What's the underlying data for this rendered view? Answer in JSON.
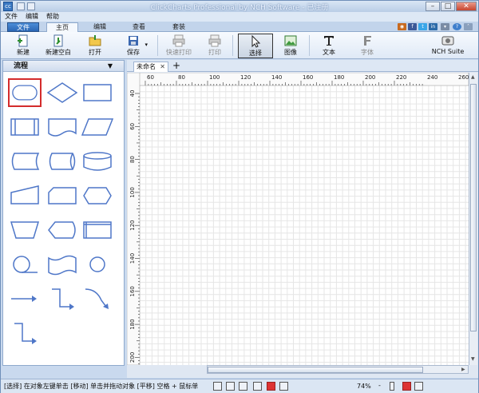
{
  "window": {
    "title": "ClickCharts Professional by NCH Software - 已注册",
    "controls": [
      "–",
      "□",
      "✕"
    ]
  },
  "menu": [
    "文件",
    "编辑",
    "帮助"
  ],
  "tabs": {
    "file": "文件",
    "items": [
      "主页",
      "编辑",
      "查看",
      "套装"
    ]
  },
  "toolbar": {
    "new": "新建",
    "new_blank": "新建空白",
    "open": "打开",
    "save": "保存",
    "quick_print": "快速打印",
    "print": "打印",
    "select": "选择",
    "image": "图像",
    "text": "文本",
    "font": "字体",
    "nch_suite": "NCH Suite"
  },
  "left_panel": {
    "category": "流程",
    "dropdown_arrow": "▼"
  },
  "document": {
    "tab_name": "未命名",
    "tab_close": "✕",
    "add_tab": "+"
  },
  "ruler": {
    "h_labels": [
      "60",
      "80",
      "100",
      "120",
      "140",
      "160",
      "180",
      "200",
      "220",
      "240",
      "260"
    ],
    "v_labels": [
      "40",
      "60",
      "80",
      "100",
      "120",
      "140",
      "160",
      "180",
      "200"
    ]
  },
  "status": {
    "hint": "[选择] 在对象左键单击 [移动] 单击并拖动对象 [平移] 空格 + 鼠标单",
    "zoom": "74%"
  },
  "colors": {
    "shape_stroke": "#4f77c8",
    "selection": "#d42c2c",
    "file_tab": "#2b67b5"
  }
}
